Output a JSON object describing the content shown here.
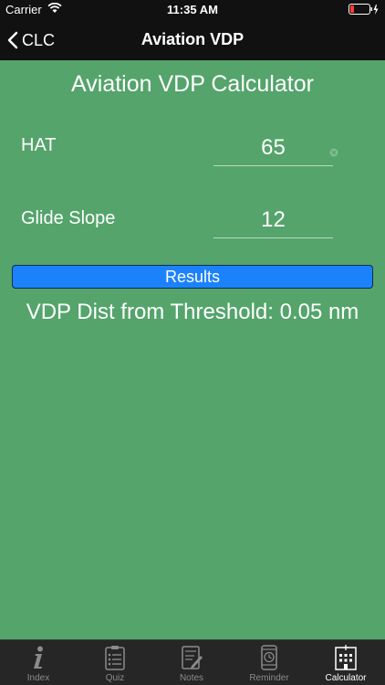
{
  "status_bar": {
    "carrier": "Carrier",
    "time": "11:35 AM"
  },
  "nav": {
    "back_label": "CLC",
    "title": "Aviation VDP"
  },
  "calculator": {
    "title": "Aviation VDP Calculator",
    "fields": [
      {
        "label": "HAT",
        "value": "65"
      },
      {
        "label": "Glide Slope",
        "value": "12"
      }
    ],
    "results_button": "Results",
    "result_text": "VDP Dist from Threshold: 0.05 nm"
  },
  "tabs": [
    {
      "label": "Index",
      "icon": "info-icon",
      "active": false
    },
    {
      "label": "Quiz",
      "icon": "clipboard-icon",
      "active": false
    },
    {
      "label": "Notes",
      "icon": "notes-icon",
      "active": false
    },
    {
      "label": "Reminder",
      "icon": "phone-clock-icon",
      "active": false
    },
    {
      "label": "Calculator",
      "icon": "calculator-icon",
      "active": true
    }
  ],
  "colors": {
    "background": "#54a46b",
    "results_button": "#1c82fb",
    "bar": "#111111",
    "tab_bar": "#262626"
  }
}
